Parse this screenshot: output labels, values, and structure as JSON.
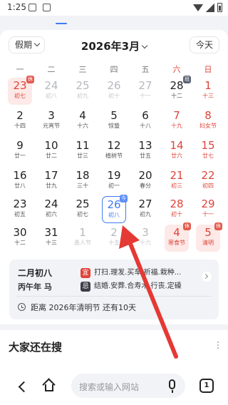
{
  "status_bar": {
    "time": "1:25"
  },
  "toolbar": {
    "holiday_dropdown": "假期",
    "month_title": "2026年3月",
    "today_button": "今天"
  },
  "weekdays": [
    "一",
    "二",
    "三",
    "四",
    "五",
    "六",
    "日"
  ],
  "calendar": {
    "days": [
      {
        "num": "23",
        "sub": "初七",
        "style": "red rest-bg",
        "badge": "休",
        "badge_type": "rest"
      },
      {
        "num": "24",
        "sub": "初八",
        "style": "gray"
      },
      {
        "num": "25",
        "sub": "初九",
        "style": "gray"
      },
      {
        "num": "26",
        "sub": "初十",
        "style": "gray"
      },
      {
        "num": "27",
        "sub": "十一",
        "style": "gray"
      },
      {
        "num": "28",
        "sub": "十二",
        "style": "",
        "badge": "班",
        "badge_type": "work"
      },
      {
        "num": "1",
        "sub": "十三",
        "style": "red"
      },
      {
        "num": "2",
        "sub": "十四",
        "style": ""
      },
      {
        "num": "3",
        "sub": "元宵节",
        "style": ""
      },
      {
        "num": "4",
        "sub": "十六",
        "style": ""
      },
      {
        "num": "5",
        "sub": "惊蛰",
        "style": ""
      },
      {
        "num": "6",
        "sub": "十八",
        "style": ""
      },
      {
        "num": "7",
        "sub": "十九",
        "style": "red"
      },
      {
        "num": "8",
        "sub": "妇女节",
        "style": "red"
      },
      {
        "num": "9",
        "sub": "廿一",
        "style": ""
      },
      {
        "num": "10",
        "sub": "廿二",
        "style": ""
      },
      {
        "num": "11",
        "sub": "廿三",
        "style": ""
      },
      {
        "num": "12",
        "sub": "植树节",
        "style": ""
      },
      {
        "num": "13",
        "sub": "廿五",
        "style": ""
      },
      {
        "num": "14",
        "sub": "廿六",
        "style": "red"
      },
      {
        "num": "15",
        "sub": "廿七",
        "style": "red"
      },
      {
        "num": "16",
        "sub": "廿八",
        "style": ""
      },
      {
        "num": "17",
        "sub": "廿九",
        "style": ""
      },
      {
        "num": "18",
        "sub": "三十",
        "style": ""
      },
      {
        "num": "19",
        "sub": "初一",
        "style": ""
      },
      {
        "num": "20",
        "sub": "春分",
        "style": ""
      },
      {
        "num": "21",
        "sub": "初三",
        "style": "red"
      },
      {
        "num": "22",
        "sub": "初四",
        "style": "red"
      },
      {
        "num": "23",
        "sub": "初五",
        "style": ""
      },
      {
        "num": "24",
        "sub": "初六",
        "style": ""
      },
      {
        "num": "25",
        "sub": "初七",
        "style": ""
      },
      {
        "num": "26",
        "sub": "初八",
        "style": "selected",
        "badge": "今",
        "badge_type": "info"
      },
      {
        "num": "27",
        "sub": "初九",
        "style": ""
      },
      {
        "num": "28",
        "sub": "初十",
        "style": "red"
      },
      {
        "num": "29",
        "sub": "十一",
        "style": "red"
      },
      {
        "num": "30",
        "sub": "十二",
        "style": ""
      },
      {
        "num": "31",
        "sub": "十三",
        "style": ""
      },
      {
        "num": "1",
        "sub": "愚人节",
        "style": "gray"
      },
      {
        "num": "2",
        "sub": "十五",
        "style": "gray"
      },
      {
        "num": "3",
        "sub": "十六",
        "style": "gray"
      },
      {
        "num": "4",
        "sub": "寒食节",
        "style": "red rest-bg",
        "badge": "休",
        "badge_type": "rest"
      },
      {
        "num": "5",
        "sub": "清明",
        "style": "red rest-bg",
        "badge": "休",
        "badge_type": "rest"
      }
    ]
  },
  "info": {
    "lunar_date": "二月初八",
    "ganzhi": "丙午年 马",
    "yi_label": "宜",
    "yi_text": "打扫.理发.买车.祈福.栽种...",
    "ji_label": "忌",
    "ji_text": "结婚.安葬.合寿木.行丧.定磉",
    "countdown": "距离 2026年清明节 还有10天"
  },
  "search_section": {
    "title": "大家还在搜"
  },
  "bottom_bar": {
    "search_placeholder": "搜索或输入网站",
    "tab_count": "1"
  },
  "colors": {
    "accent": "#3e7bf5",
    "holiday_red": "#e0443a",
    "annotation_arrow": "#e53935"
  },
  "icons": [
    "gallery-icon",
    "a-icon",
    "wifi-icon",
    "signal-icon",
    "battery-icon",
    "clock-icon",
    "back-icon",
    "home-icon",
    "mic-icon",
    "tabs-icon",
    "chevron-right-icon"
  ]
}
